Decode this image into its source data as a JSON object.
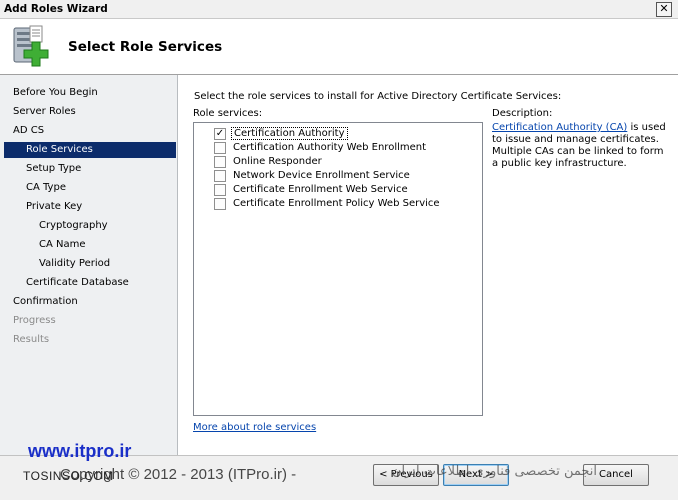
{
  "window": {
    "title": "Add Roles Wizard",
    "close_glyph": "✕"
  },
  "header": {
    "title": "Select Role Services",
    "icon": "server-add-icon"
  },
  "nav": {
    "items": [
      {
        "label": "Before You Begin",
        "state": "normal"
      },
      {
        "label": "Server Roles",
        "state": "normal"
      },
      {
        "label": "AD CS",
        "state": "normal"
      },
      {
        "label": "Role Services",
        "state": "selected"
      },
      {
        "label": "Setup Type",
        "state": "normal"
      },
      {
        "label": "CA Type",
        "state": "normal"
      },
      {
        "label": "Private Key",
        "state": "normal"
      },
      {
        "label": "Cryptography",
        "state": "normal"
      },
      {
        "label": "CA Name",
        "state": "normal"
      },
      {
        "label": "Validity Period",
        "state": "normal"
      },
      {
        "label": "Certificate Database",
        "state": "normal"
      },
      {
        "label": "Confirmation",
        "state": "normal"
      },
      {
        "label": "Progress",
        "state": "disabled"
      },
      {
        "label": "Results",
        "state": "disabled"
      }
    ]
  },
  "main": {
    "prompt": "Select the role services to install for Active Directory Certificate Services:",
    "role_services_label": "Role services:",
    "role_services": [
      {
        "label": "Certification Authority",
        "checked": true
      },
      {
        "label": "Certification Authority Web Enrollment",
        "checked": false
      },
      {
        "label": "Online Responder",
        "checked": false
      },
      {
        "label": "Network Device Enrollment Service",
        "checked": false
      },
      {
        "label": "Certificate Enrollment Web Service",
        "checked": false
      },
      {
        "label": "Certificate Enrollment Policy Web Service",
        "checked": false
      }
    ],
    "description_label": "Description:",
    "description_link": "Certification Authority (CA)",
    "description_text": " is used to issue and manage certificates. Multiple CAs can be linked to form a public key infrastructure.",
    "more_link": "More about role services"
  },
  "footer": {
    "previous_label": "< Previous",
    "next_label": "Next >",
    "cancel_label": "Cancel"
  },
  "watermark": {
    "url": "www.itpro.ir",
    "copyright": "Copyright © 2012 - 2013 (ITPro.ir) -",
    "tosinso": "TOSINSO.COM",
    "persian": "انجمن تخصصی فناوری اطلاعات ایران"
  }
}
